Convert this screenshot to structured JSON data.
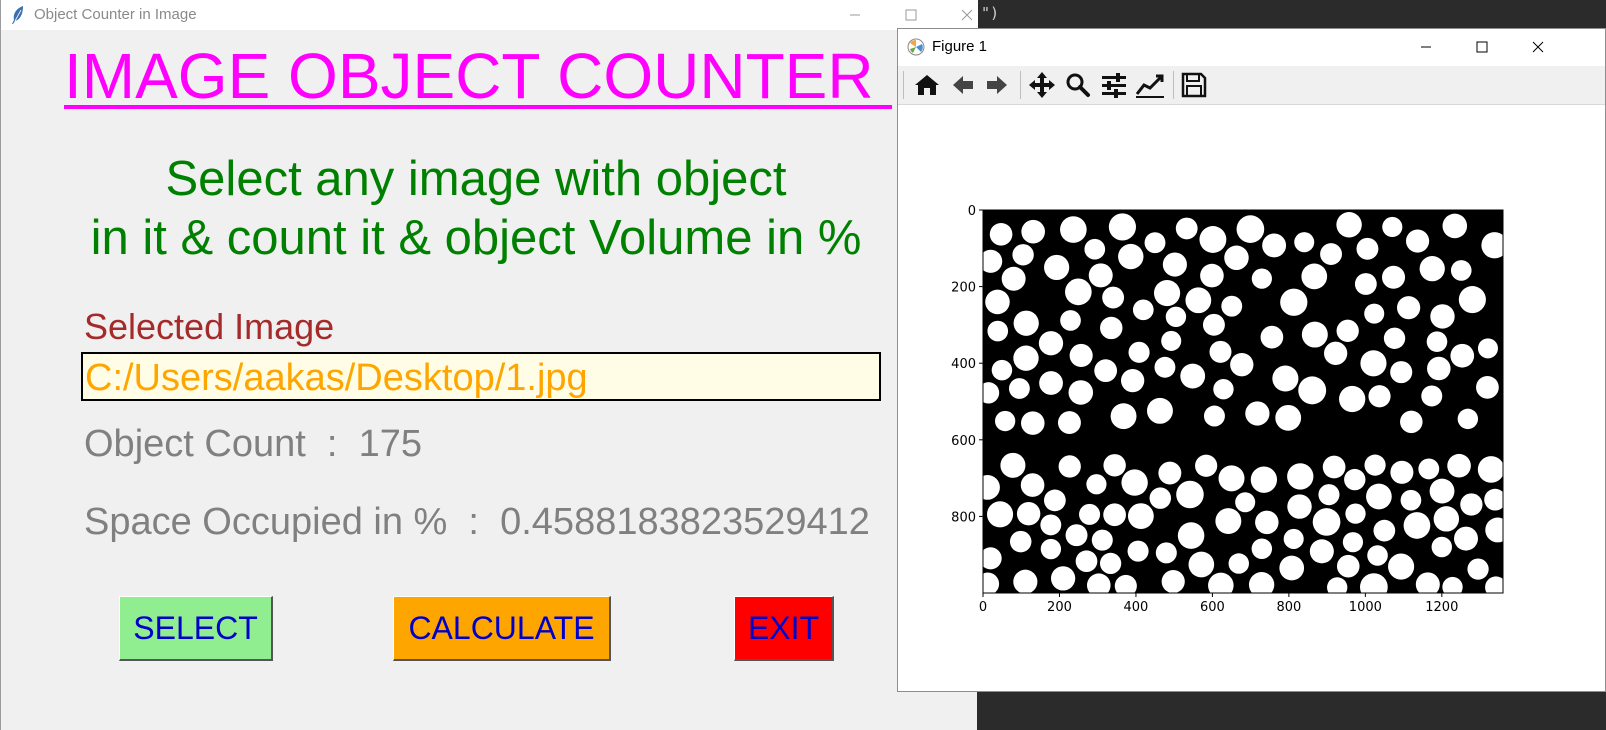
{
  "editor": {
    "code_fragment": "\")"
  },
  "tk_window": {
    "title": "Object Counter in Image",
    "heading": "IMAGE OBJECT COUNTER",
    "instruction_line1": "Select any image with object",
    "instruction_line2": "in it & count it & object Volume in %",
    "selected_label": "Selected Image",
    "selected_path": "C:/Users/aakas/Desktop/1.jpg",
    "object_count": "Object Count  :  175",
    "space_occupied": "Space Occupied in %  :  0.4588183823529412",
    "buttons": {
      "select": "SELECT",
      "calculate": "CALCULATE",
      "exit": "EXIT"
    },
    "colors": {
      "heading": "#ff00ff",
      "instruction": "#008000",
      "label": "#a52a2a",
      "path": "#ffa500",
      "stats": "#808080",
      "select_bg": "#90ee90",
      "calculate_bg": "#ffa500",
      "exit_bg": "#ff0000",
      "button_text": "#0000cd"
    }
  },
  "figure_window": {
    "title": "Figure 1",
    "toolbar": [
      "home-icon",
      "back-icon",
      "forward-icon",
      "pan-icon",
      "zoom-icon",
      "subplots-icon",
      "customize-icon",
      "save-icon"
    ],
    "axes": {
      "x_ticks": [
        "0",
        "200",
        "400",
        "600",
        "800",
        "1000",
        "1200"
      ],
      "y_ticks": [
        "0",
        "200",
        "400",
        "600",
        "800"
      ],
      "xlim": [
        0,
        1360
      ],
      "ylim": [
        1000,
        0
      ],
      "image": "binary thresholded image of white circular objects on black background"
    }
  }
}
